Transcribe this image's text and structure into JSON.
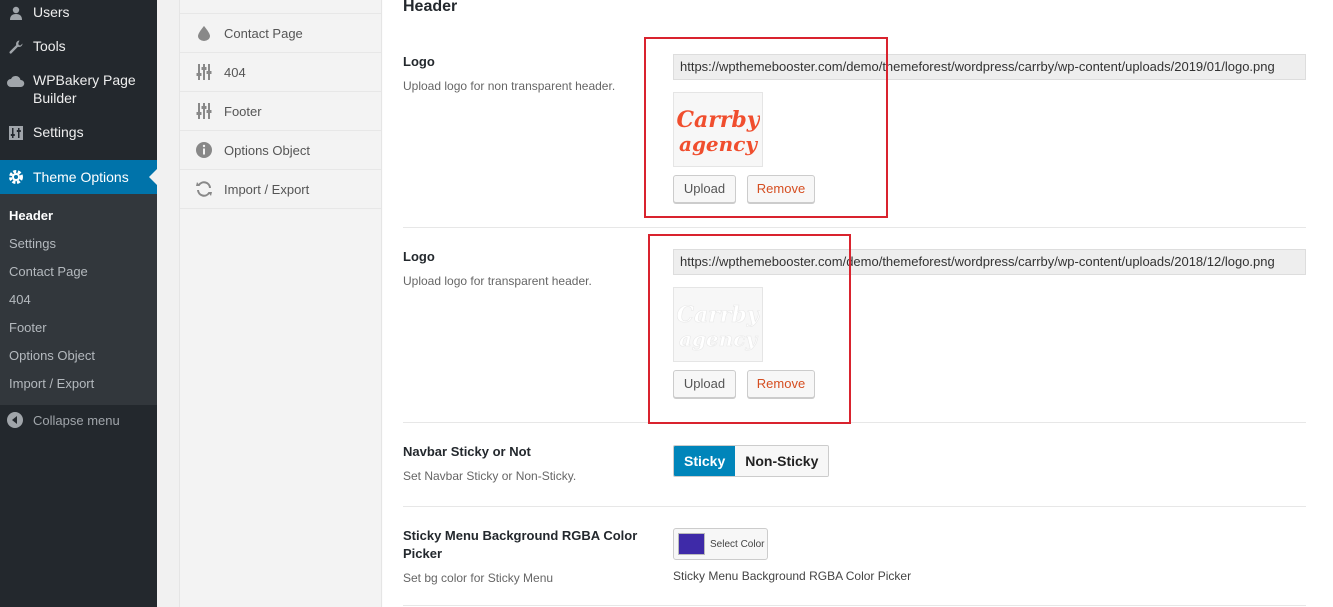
{
  "sidebar": {
    "items": [
      {
        "label": "Users",
        "icon": "user-icon"
      },
      {
        "label": "Tools",
        "icon": "wrench-icon"
      },
      {
        "label": "WPBakery Page Builder",
        "icon": "cloud-icon"
      },
      {
        "label": "Settings",
        "icon": "sliders-icon"
      }
    ],
    "current": {
      "label": "Theme Options",
      "icon": "gear-icon"
    },
    "submenu": [
      "Header",
      "Settings",
      "Contact Page",
      "404",
      "Footer",
      "Options Object",
      "Import / Export"
    ],
    "collapse_label": "Collapse menu"
  },
  "options_nav": [
    {
      "label": "Contact Page",
      "icon": "droplet-icon"
    },
    {
      "label": "404",
      "icon": "sliders-icon"
    },
    {
      "label": "Footer",
      "icon": "sliders-icon"
    },
    {
      "label": "Options Object",
      "icon": "info-icon"
    },
    {
      "label": "Import / Export",
      "icon": "refresh-icon"
    }
  ],
  "content": {
    "section_title": "Header",
    "logo1": {
      "label": "Logo",
      "desc": "Upload logo for non transparent header.",
      "url": "https://wpthemebooster.com/demo/themeforest/wordpress/carrby/wp-content/uploads/2019/01/logo.png",
      "upload": "Upload",
      "remove": "Remove",
      "logo_line1": "Carrby",
      "logo_line2": "agency",
      "logo_color": "#f04e2e"
    },
    "logo2": {
      "label": "Logo",
      "desc": "Upload logo for transparent header.",
      "url": "https://wpthemebooster.com/demo/themeforest/wordpress/carrby/wp-content/uploads/2018/12/logo.png",
      "upload": "Upload",
      "remove": "Remove",
      "logo_line1": "Carrby",
      "logo_line2": "agency",
      "logo_color": "#ffffff"
    },
    "navbar": {
      "label": "Navbar Sticky or Not",
      "desc": "Set Navbar Sticky or Non-Sticky.",
      "options": [
        "Sticky",
        "Non-Sticky"
      ]
    },
    "sticky_bg": {
      "label": "Sticky Menu Background RGBA Color Picker",
      "desc": "Set bg color for Sticky Menu",
      "button": "Select Color",
      "caption": "Sticky Menu Background RGBA Color Picker",
      "swatch_color": "#3e2aa8"
    }
  }
}
